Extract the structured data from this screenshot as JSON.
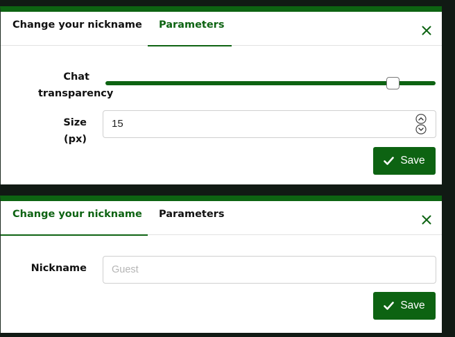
{
  "panel_top": {
    "tabs": {
      "nickname_label": "Change your nickname",
      "parameters_label": "Parameters",
      "active": "parameters"
    },
    "transparency_label_line1": "Chat",
    "transparency_label_line2": "transparency",
    "transparency_value": 0.87,
    "size_label": "Size (px)",
    "size_value": "15",
    "save_label": "Save"
  },
  "panel_bottom": {
    "tabs": {
      "nickname_label": "Change your nickname",
      "parameters_label": "Parameters",
      "active": "nickname"
    },
    "nickname_label": "Nickname",
    "nickname_placeholder": "Guest",
    "save_label": "Save"
  },
  "icons": {
    "close": "close-icon",
    "save": "checkmark-icon",
    "spin_up": "chevron-up-icon",
    "spin_down": "chevron-down-icon"
  },
  "colors": {
    "accent": "#0d6312",
    "backdrop": "#111a14"
  }
}
